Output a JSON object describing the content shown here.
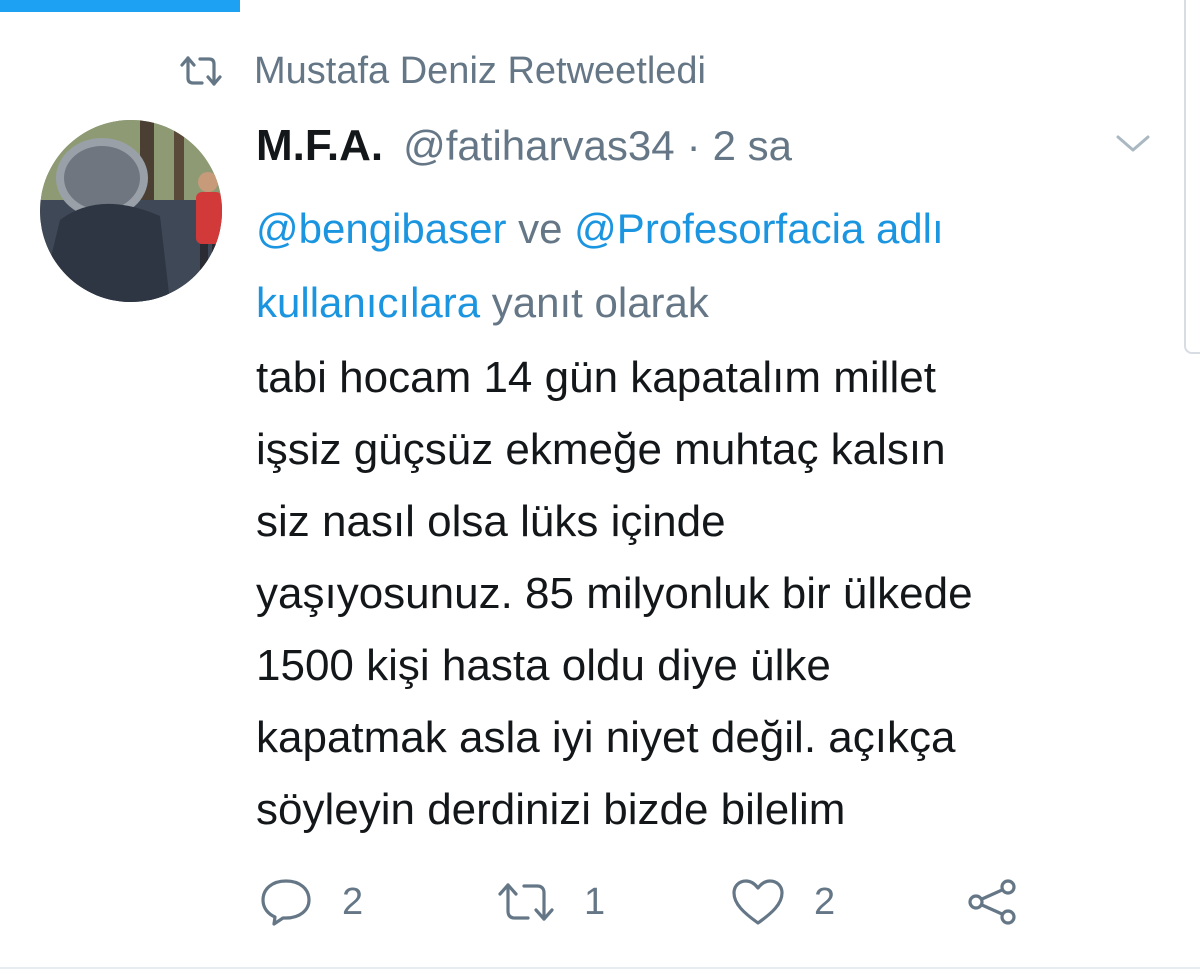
{
  "retweet": {
    "icon": "retweet-icon",
    "text": "Mustafa Deniz Retweetledi"
  },
  "tweet": {
    "author_name": "M.F.A.",
    "handle": "@fatiharvas34",
    "separator": "·",
    "time": "2 sa",
    "reply_context": {
      "mention_1": "@bengibaser",
      "joiner": "ve",
      "mention_2": "@Profesorfacia",
      "mention_suffix": "adlı kullanıcılara",
      "tail": "yanıt olarak"
    },
    "body_lines": [
      "tabi hocam 14 gün kapatalım millet",
      "işsiz güçsüz ekmeğe muhtaç kalsın",
      "siz nasıl olsa lüks içinde",
      "yaşıyosunuz. 85 milyonluk bir ülkede",
      "1500 kişi hasta oldu diye ülke",
      "kapatmak asla iyi niyet değil. açıkça",
      "söyleyin derdinizi bizde bilelim"
    ],
    "actions": {
      "reply_count": "2",
      "retweet_count": "1",
      "like_count": "2"
    }
  },
  "icons": [
    "retweet-icon",
    "chevron-down-icon",
    "reply-icon",
    "retweet-action-icon",
    "heart-icon",
    "share-icon"
  ],
  "colors": {
    "accent": "#1da1f2",
    "link": "#1b95e0",
    "secondary_text": "#657786",
    "primary_text": "#14171a"
  }
}
